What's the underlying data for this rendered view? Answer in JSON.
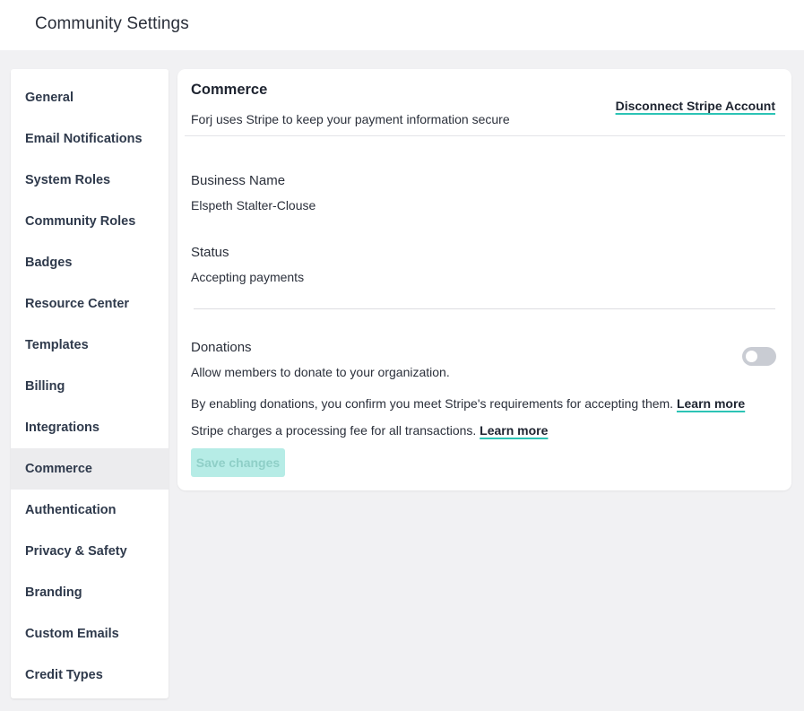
{
  "header": {
    "title": "Community Settings"
  },
  "sidebar": {
    "items": [
      {
        "label": "General"
      },
      {
        "label": "Email Notifications"
      },
      {
        "label": "System Roles"
      },
      {
        "label": "Community Roles"
      },
      {
        "label": "Badges"
      },
      {
        "label": "Resource Center"
      },
      {
        "label": "Templates"
      },
      {
        "label": "Billing"
      },
      {
        "label": "Integrations"
      },
      {
        "label": "Commerce"
      },
      {
        "label": "Authentication"
      },
      {
        "label": "Privacy & Safety"
      },
      {
        "label": "Branding"
      },
      {
        "label": "Custom Emails"
      },
      {
        "label": "Credit Types"
      }
    ],
    "active": "Commerce"
  },
  "commerce": {
    "title": "Commerce",
    "subtitle": "Forj uses Stripe to keep your payment information secure",
    "disconnect_label": "Disconnect Stripe Account",
    "business_name_label": "Business Name",
    "business_name_value": "Elspeth Stalter-Clouse",
    "status_label": "Status",
    "status_value": "Accepting payments",
    "donations": {
      "label": "Donations",
      "description": "Allow members to donate to your organization.",
      "enabled": false,
      "requirements_text": "By enabling donations, you confirm you meet Stripe's requirements for accepting them.",
      "requirements_link": "Learn more",
      "fee_text": "Stripe charges a processing fee for all transactions.",
      "fee_link": "Learn more"
    },
    "save_label": "Save changes"
  },
  "colors": {
    "accent": "#2cc3b5",
    "save_button_bg": "#b6ece6",
    "toggle_off": "#c9ccd3",
    "page_bg": "#f1f1f3"
  }
}
